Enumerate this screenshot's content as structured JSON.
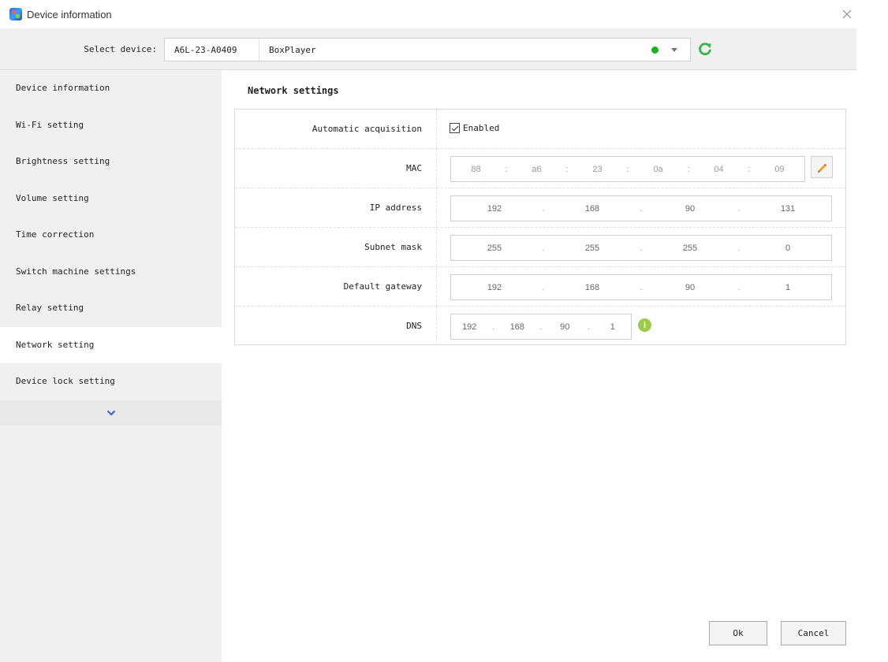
{
  "window": {
    "title": "Device information"
  },
  "device_bar": {
    "label": "Select device:",
    "device_id": "A6L-23-A0409",
    "device_name": "BoxPlayer",
    "status_color": "#18b418",
    "refresh_icon": "refresh-icon"
  },
  "sidebar": {
    "items": [
      {
        "label": "Device information"
      },
      {
        "label": "Wi-Fi setting"
      },
      {
        "label": "Brightness setting"
      },
      {
        "label": "Volume setting"
      },
      {
        "label": "Time correction"
      },
      {
        "label": "Switch machine settings"
      },
      {
        "label": "Relay setting"
      },
      {
        "label": "Network setting",
        "active": true
      },
      {
        "label": "Device lock setting"
      }
    ],
    "more_icon": "chevron-down-icon"
  },
  "network": {
    "title": "Network settings",
    "auto": {
      "label": "Automatic acquisition",
      "checkbox_label": "Enabled",
      "checked": true
    },
    "mac": {
      "label": "MAC",
      "octets": [
        "88",
        "a6",
        "23",
        "0a",
        "04",
        "09"
      ],
      "separator": ":"
    },
    "ip": {
      "label": "IP address",
      "octets": [
        "192",
        "168",
        "90",
        "131"
      ],
      "separator": "."
    },
    "subnet": {
      "label": "Subnet mask",
      "octets": [
        "255",
        "255",
        "255",
        "0"
      ],
      "separator": "."
    },
    "gateway": {
      "label": "Default gateway",
      "octets": [
        "192",
        "168",
        "90",
        "1"
      ],
      "separator": "."
    },
    "dns": {
      "label": "DNS",
      "octets": [
        "192",
        "168",
        "90",
        "1"
      ],
      "separator": "."
    }
  },
  "footer": {
    "ok_label": "Ok",
    "cancel_label": "Cancel"
  }
}
